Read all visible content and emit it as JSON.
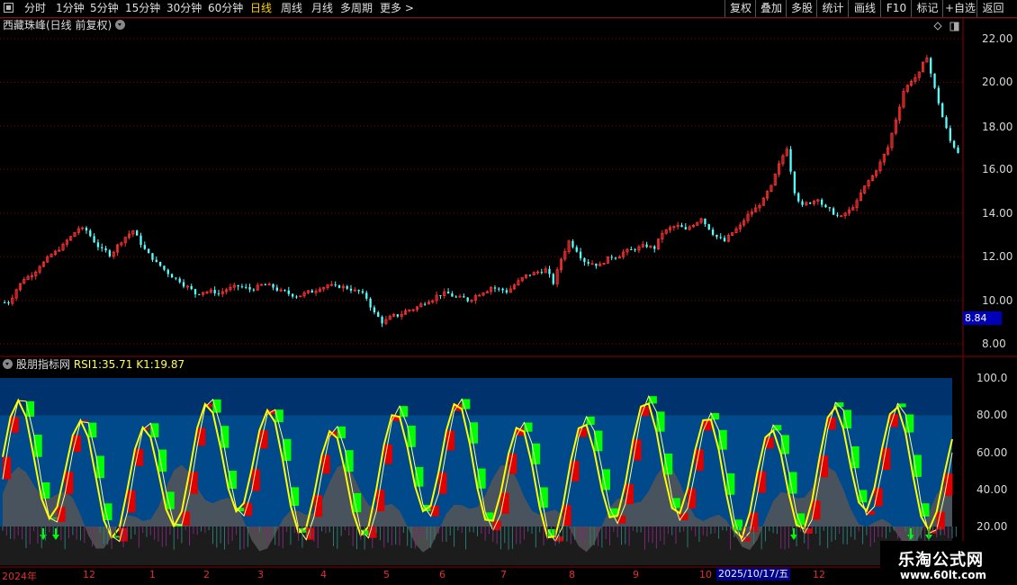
{
  "toolbar": {
    "periods": [
      "分时",
      "1分钟",
      "5分钟",
      "15分钟",
      "30分钟",
      "60分钟",
      "日线",
      "周线",
      "月线",
      "多周期",
      "更多 >"
    ],
    "active_period": "日线",
    "right_buttons": [
      "复权",
      "叠加",
      "多股",
      "统计",
      "画线",
      "F10",
      "标记",
      "+自选",
      "返回"
    ]
  },
  "main_chart": {
    "title": "西藏珠峰(日线 前复权)",
    "y_ticks": [
      "22.00",
      "20.00",
      "18.00",
      "16.00",
      "14.00",
      "12.00",
      "10.00",
      "8.00"
    ],
    "current_price": "8.84"
  },
  "indicator": {
    "name": "股朋指标网",
    "rsi_label": "RSI1:",
    "rsi_value": "35.71",
    "k_label": "K1:",
    "k_value": "19.87",
    "y_ticks": [
      "100.0",
      "80.00",
      "60.00",
      "40.00",
      "20.00"
    ]
  },
  "date_axis": {
    "labels": [
      "2024年",
      "12",
      "1",
      "2",
      "3",
      "4",
      "5",
      "6",
      "7",
      "8",
      "9",
      "10",
      "12"
    ],
    "highlight": "2025/10/17/五"
  },
  "watermark": {
    "line1": "乐淘公式网",
    "line2": "www.60lt.com"
  },
  "colors": {
    "up": "#ff3232",
    "down": "#54ffff",
    "rsi": "#ffff00",
    "fill_red": "#e00000",
    "fill_green": "#00ff00",
    "band": "#004a8c",
    "grid": "#8b0000"
  },
  "chart_data": {
    "type": "candlestick",
    "y_range": [
      8,
      22.5
    ],
    "closes": [
      9.9,
      10.5,
      11.0,
      11.2,
      11.6,
      11.9,
      12.2,
      12.5,
      12.9,
      13.3,
      13.2,
      12.7,
      12.3,
      12.1,
      12.5,
      12.9,
      13.2,
      12.6,
      12.1,
      11.7,
      11.4,
      11.1,
      10.9,
      10.6,
      10.3,
      10.4,
      10.4,
      10.3,
      10.5,
      10.6,
      10.6,
      10.5,
      10.6,
      10.7,
      10.6,
      10.4,
      10.3,
      10.2,
      10.3,
      10.4,
      10.6,
      10.7,
      10.6,
      10.6,
      10.5,
      10.4,
      10.1,
      9.4,
      9.0,
      9.2,
      9.3,
      9.5,
      9.6,
      9.8,
      10.0,
      10.2,
      10.3,
      10.2,
      10.1,
      10.0,
      10.2,
      10.4,
      10.6,
      10.5,
      10.4,
      10.7,
      11.0,
      11.2,
      11.3,
      11.4,
      10.8,
      11.9,
      12.7,
      12.3,
      11.8,
      11.7,
      11.6,
      11.9,
      12.0,
      12.2,
      12.3,
      12.4,
      12.5,
      12.4,
      13.1,
      13.3,
      13.4,
      13.2,
      13.5,
      13.8,
      13.3,
      12.9,
      12.7,
      13.1,
      13.4,
      13.9,
      14.2,
      14.6,
      15.2,
      16.2,
      17.0,
      15.0,
      14.3,
      14.5,
      14.7,
      14.2,
      14.0,
      13.8,
      14.1,
      14.5,
      15.2,
      15.7,
      16.3,
      17.0,
      18.3,
      19.6,
      20.1,
      20.4,
      21.2,
      19.7,
      18.4,
      17.3,
      16.8
    ]
  }
}
